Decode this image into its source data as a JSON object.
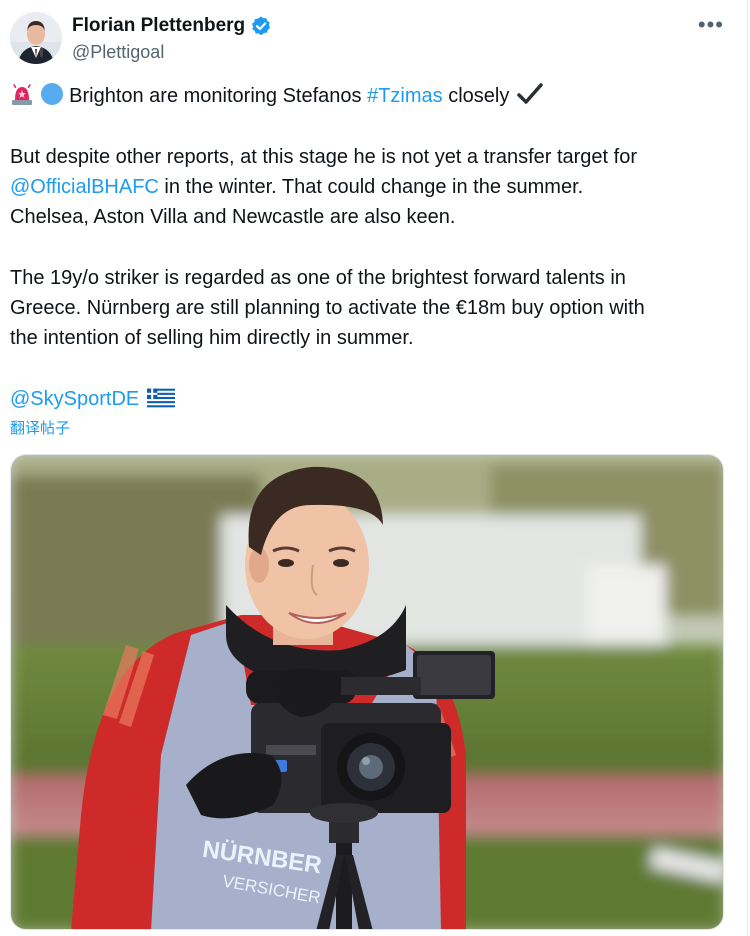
{
  "author": {
    "display_name": "Florian Plettenberg",
    "handle": "@Plettigoal",
    "verified": true,
    "verified_color": "#1d9bf0"
  },
  "menu": {
    "more_icon": "more-horizontal-icon",
    "more_glyph": "•••"
  },
  "tweet": {
    "line1": {
      "emojis": [
        "police-siren-emoji",
        "blue-circle-emoji"
      ],
      "before": "Brighton are monitoring Stefanos ",
      "hashtag": "#Tzimas",
      "after": " closely",
      "trailing_emoji": "heavy-check-mark-emoji"
    },
    "para2": {
      "line1": "But despite other reports, at this stage he is not yet a transfer target for",
      "mention": "@OfficialBHAFC",
      "line2_rest": " in the winter. That could change in the summer.",
      "line3": "Chelsea, Aston Villa and Newcastle are also keen."
    },
    "para3": {
      "line1": "The 19y/o striker is regarded as one of the brightest forward talents in",
      "line2": "Greece. Nürnberg are still planning to activate the €18m buy option with",
      "line3": "the intention of selling him directly in summer."
    },
    "source_mention": "@SkySportDE",
    "source_flag": "greece-flag-emoji"
  },
  "translate_label": "翻译帖子",
  "media": {
    "alt": "young-football-player-with-video-camera-photo",
    "shirt_text_1": "NÜRNBER",
    "shirt_text_2": "VERSICHER"
  },
  "colors": {
    "text": "#0f1419",
    "secondary": "#536471",
    "link": "#1d9bf0"
  }
}
